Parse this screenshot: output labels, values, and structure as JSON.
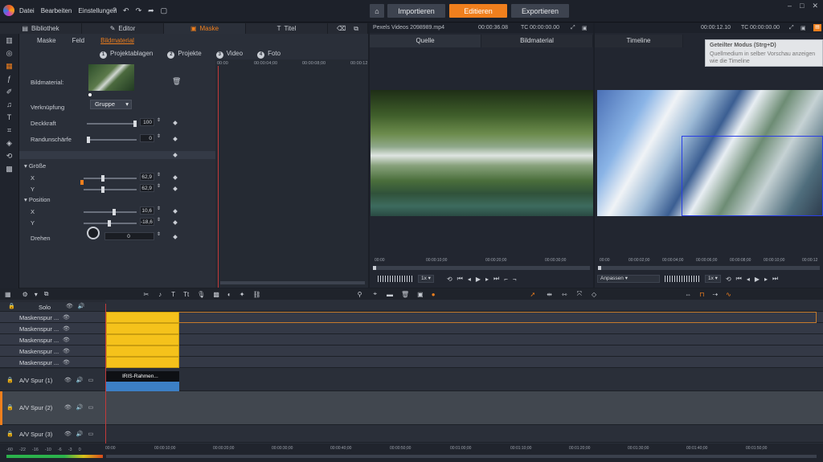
{
  "menu": {
    "items": [
      "Datei",
      "Bearbeiten",
      "Einstellungen"
    ],
    "help": "?"
  },
  "modes": {
    "import": "Importieren",
    "edit": "Editieren",
    "export": "Exportieren"
  },
  "lefttabs": [
    "Bibliothek",
    "Editor",
    "Maske",
    "Titel"
  ],
  "mask": {
    "subtabs": [
      "Maske",
      "Feld",
      "Bildmaterial"
    ],
    "nav": [
      {
        "n": "1",
        "label": "Projektablagen"
      },
      {
        "n": "2",
        "label": "Projekte"
      },
      {
        "n": "3",
        "label": "Video"
      },
      {
        "n": "4",
        "label": "Foto"
      }
    ],
    "image_label": "Bildmaterial:",
    "link_label": "Verknüpfung",
    "link_value": "Gruppe",
    "opacity_label": "Deckkraft",
    "opacity_value": "100",
    "edge_label": "Randunschärfe",
    "edge_value": "0",
    "size_label": "Größe",
    "size_x_label": "X",
    "size_x": "62,9",
    "size_y_label": "Y",
    "size_y": "62,9",
    "position_label": "Position",
    "pos_x_label": "X",
    "pos_x": "10,6",
    "pos_y_label": "Y",
    "pos_y": "-18,6",
    "rotate_label": "Drehen",
    "rotate_value": "0",
    "kf_ruler": [
      "00:00",
      "00:00:04;00",
      "00:00:08;00",
      "00:00:12"
    ]
  },
  "source": {
    "file": "Pexels Videos 2098989.mp4",
    "duration": "00:00:36.08",
    "tc_label": "TC",
    "tc": "00:00:00.00",
    "tabs": [
      "Quelle",
      "Bildmaterial"
    ],
    "ruler": [
      "00:00",
      "00:00:10;00",
      "00:00:20;00",
      "00:00:30;00"
    ],
    "speed": "1x"
  },
  "preview": {
    "duration": "00:00:12.10",
    "tc_label": "TC",
    "tc": "00:00:00.00",
    "tab": "Timeline",
    "ruler": [
      "00:00",
      "00:00:02;00",
      "00:00:04;00",
      "00:00:06;00",
      "00:00:08;00",
      "00:00:10;00",
      "00:00:12"
    ],
    "fit": "Anpassen",
    "speed": "1x"
  },
  "tooltip": {
    "title": "Geteilter Modus (Strg+D)",
    "text": "Quellmedium in selber Vorschau anzeigen wie die Timeline"
  },
  "tracks": {
    "solo": "Solo",
    "items": [
      {
        "name": "Maskenspur ..."
      },
      {
        "name": "Maskenspur ..."
      },
      {
        "name": "Maskenspur ..."
      },
      {
        "name": "Maskenspur ..."
      },
      {
        "name": "Maskenspur ..."
      }
    ],
    "av1": "A/V Spur (1)",
    "av2": "A/V Spur (2)",
    "av3": "A/V Spur (3)",
    "clip_label": "IRIS-Rahmen..."
  },
  "bottom": {
    "ruler": [
      "00:00",
      "00:00:10;00",
      "00:00:20;00",
      "00:00:30;00",
      "00:00:40;00",
      "00:00:50;00",
      "00:01:00;00",
      "00:01:10;00",
      "00:01:20;00",
      "00:01:30;00",
      "00:01:40;00",
      "00:01:50;00"
    ],
    "vu": [
      "-60",
      "-22",
      "-16",
      "-10",
      "-6",
      "-3",
      "0"
    ]
  },
  "colors": {
    "accent": "#f07f1d",
    "mask_clip": "#f5c21b",
    "av_clip": "#3c7fc4",
    "selection": "#2a3ee6"
  }
}
